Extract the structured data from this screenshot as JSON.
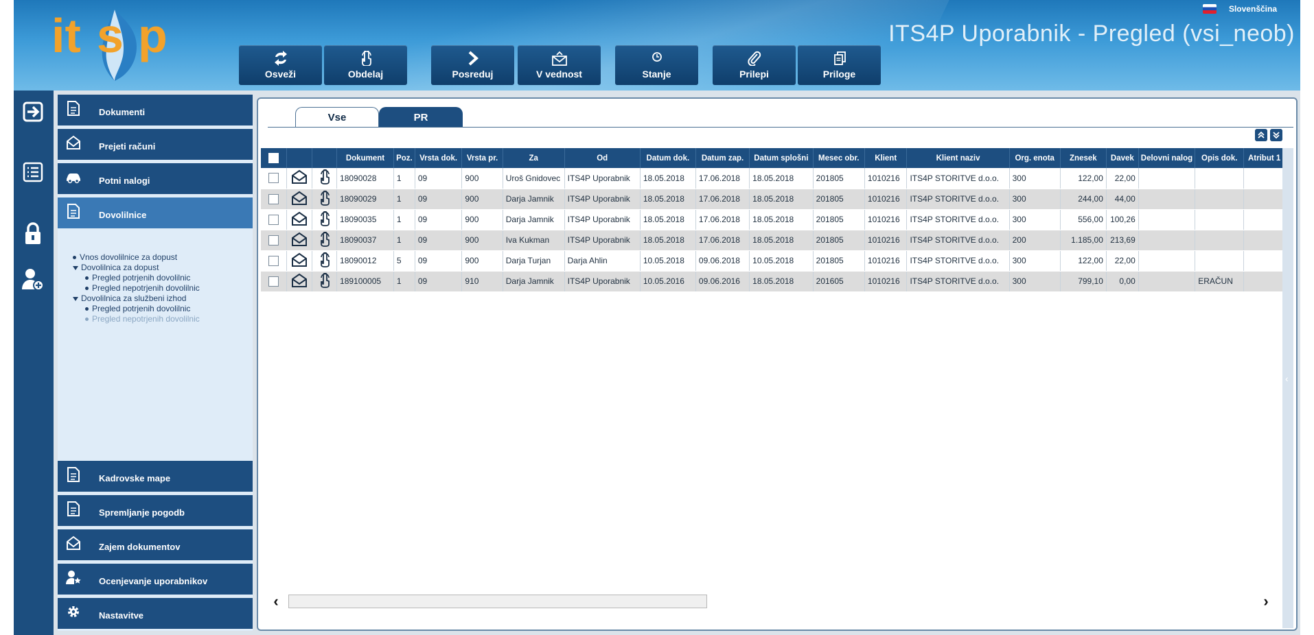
{
  "header": {
    "logo_text": "its4p",
    "title": "ITS4P Uporabnik - Pregled (vsi_neob)",
    "language": "Slovenščina"
  },
  "toolbar": [
    {
      "label": "Osveži",
      "icon": "refresh-icon"
    },
    {
      "label": "Obdelaj",
      "icon": "touch-icon"
    },
    {
      "label": "Posreduj",
      "icon": "forward-icon"
    },
    {
      "label": "V vednost",
      "icon": "mail-icon"
    },
    {
      "label": "Stanje",
      "icon": "status-icon"
    },
    {
      "label": "Prilepi",
      "icon": "paperclip-icon"
    },
    {
      "label": "Priloge",
      "icon": "attachments-icon"
    }
  ],
  "sidebar_icons": [
    "logout-icon",
    "list-icon",
    "lock-icon",
    "add-user-icon"
  ],
  "nav": {
    "items": [
      {
        "label": "Dokumenti",
        "icon": "document-icon"
      },
      {
        "label": "Prejeti računi",
        "icon": "envelope-icon"
      },
      {
        "label": "Potni nalogi",
        "icon": "car-icon"
      },
      {
        "label": "Dovolilnice",
        "icon": "document-icon"
      },
      {
        "label": "Kadrovske mape",
        "icon": "document-icon"
      },
      {
        "label": "Spremljanje pogodb",
        "icon": "document-icon"
      },
      {
        "label": "Zajem dokumentov",
        "icon": "envelope-icon"
      },
      {
        "label": "Ocenjevanje uporabnikov",
        "icon": "user-star-icon"
      },
      {
        "label": "Nastavitve",
        "icon": "gear-icon"
      }
    ],
    "tree": [
      {
        "label": "Vnos dovolilnice za dopust",
        "type": "leaf",
        "level": 1
      },
      {
        "label": "Dovolilnica za dopust",
        "type": "folder",
        "level": 1
      },
      {
        "label": "Pregled potrjenih dovolilnic",
        "type": "leaf",
        "level": 2
      },
      {
        "label": "Pregled nepotrjenih dovolilnic",
        "type": "leaf",
        "level": 2
      },
      {
        "label": "Dovolilnica za službeni izhod",
        "type": "folder",
        "level": 1
      },
      {
        "label": "Pregled potrjenih dovolilnic",
        "type": "leaf",
        "level": 2
      },
      {
        "label": "Pregled nepotrjenih dovolilnic",
        "type": "leaf",
        "level": 2,
        "muted": true
      }
    ]
  },
  "tabs": [
    {
      "label": "Vse",
      "active": true
    },
    {
      "label": "PR",
      "active": false
    }
  ],
  "table": {
    "columns": [
      "Dokument",
      "Poz.",
      "Vrsta dok.",
      "Vrsta pr.",
      "Za",
      "Od",
      "Datum dok.",
      "Datum zap.",
      "Datum splošni",
      "Mesec obr.",
      "Klient",
      "Klient naziv",
      "Org. enota",
      "Znesek",
      "Davek",
      "Delovni nalog",
      "Opis dok.",
      "Atribut 1"
    ],
    "rows": [
      [
        "18090028",
        "1",
        "09",
        "900",
        "Uroš Gnidovec",
        "ITS4P Uporabnik",
        "18.05.2018",
        "17.06.2018",
        "18.05.2018",
        "201805",
        "1010216",
        "ITS4P STORITVE d.o.o.",
        "300",
        "122,00",
        "22,00",
        "",
        "",
        ""
      ],
      [
        "18090029",
        "1",
        "09",
        "900",
        "Darja Jamnik",
        "ITS4P Uporabnik",
        "18.05.2018",
        "17.06.2018",
        "18.05.2018",
        "201805",
        "1010216",
        "ITS4P STORITVE d.o.o.",
        "300",
        "244,00",
        "44,00",
        "",
        "",
        ""
      ],
      [
        "18090035",
        "1",
        "09",
        "900",
        "Darja Jamnik",
        "ITS4P Uporabnik",
        "18.05.2018",
        "17.06.2018",
        "18.05.2018",
        "201805",
        "1010216",
        "ITS4P STORITVE d.o.o.",
        "300",
        "556,00",
        "100,26",
        "",
        "",
        ""
      ],
      [
        "18090037",
        "1",
        "09",
        "900",
        "Iva Kukman",
        "ITS4P Uporabnik",
        "18.05.2018",
        "17.06.2018",
        "18.05.2018",
        "201805",
        "1010216",
        "ITS4P STORITVE d.o.o.",
        "200",
        "1.185,00",
        "213,69",
        "",
        "",
        ""
      ],
      [
        "18090012",
        "5",
        "09",
        "900",
        "Darja Turjan",
        "Darja Ahlin",
        "10.05.2018",
        "09.06.2018",
        "10.05.2018",
        "201805",
        "1010216",
        "ITS4P STORITVE d.o.o.",
        "300",
        "122,00",
        "22,00",
        "",
        "",
        ""
      ],
      [
        "189100005",
        "1",
        "09",
        "910",
        "Darja Jamnik",
        "ITS4P Uporabnik",
        "10.05.2016",
        "09.06.2016",
        "18.05.2018",
        "201605",
        "1010216",
        "ITS4P STORITVE d.o.o.",
        "300",
        "799,10",
        "0,00",
        "",
        "ERAČUN",
        ""
      ]
    ]
  },
  "colors": {
    "header_dark": "#1f78ba",
    "nav_button": "#1d4e80",
    "nav_active": "#3a79b5",
    "accent_logo": "#f2a22b",
    "row_alt": "#dcdcdc"
  }
}
